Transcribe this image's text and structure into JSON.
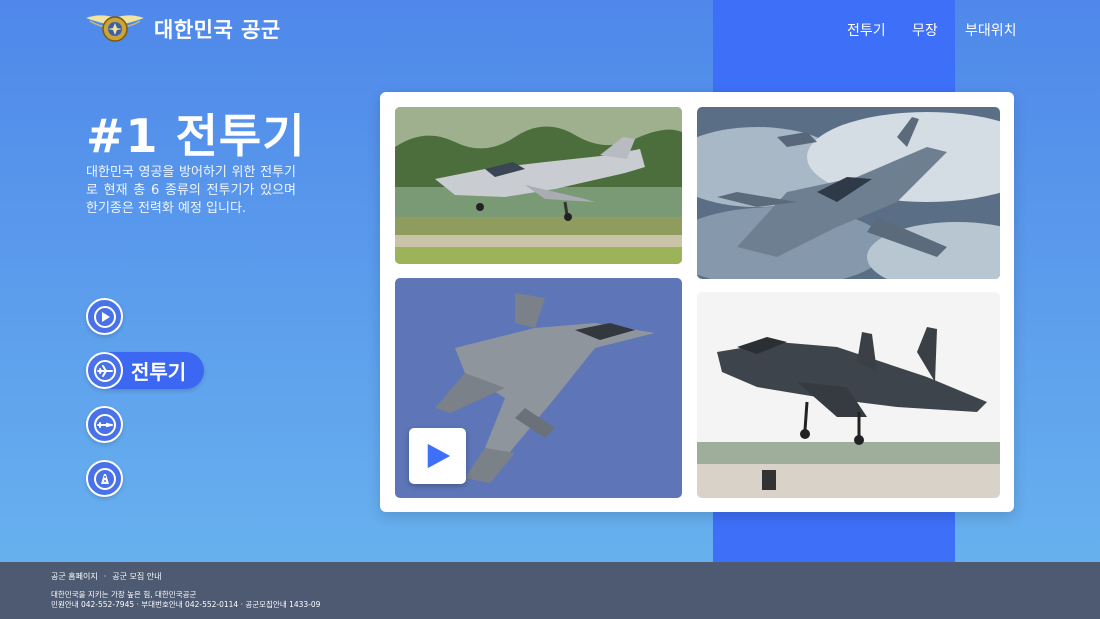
{
  "brand": {
    "name": "대한민국 공군",
    "logo_icon": "air-force-emblem-icon"
  },
  "nav": [
    {
      "label": "전투기"
    },
    {
      "label": "무장"
    },
    {
      "label": "부대위치"
    }
  ],
  "hero": {
    "title": "#1 전투기",
    "description": "대한민국 영공을 방어하기 위한 전투기로 현재 총 6 종류의 전투기가 있으며 한기종은 전력화 예정 입니다."
  },
  "side_menu": [
    {
      "icon": "play-icon"
    },
    {
      "icon": "fighter-jet-icon",
      "label": "전투기",
      "active": true
    },
    {
      "icon": "missile-icon"
    },
    {
      "icon": "location-road-icon"
    }
  ],
  "gallery": {
    "items": [
      {
        "alt": "FA-50 trainer jet taking off"
      },
      {
        "alt": "KF-21 fighter in flight"
      },
      {
        "alt": "F-35 stealth fighter"
      },
      {
        "alt": "F-15K fighter landing"
      }
    ],
    "play_icon": "play-icon"
  },
  "footer": {
    "links": [
      "공군 홈페이지",
      "공군 모집 안내"
    ],
    "slogan": "대한민국을 지키는 가장 높은 힘, 대한민국공군",
    "contacts": "민원안내 042-552-7945  ·  부대번호안내 042-552-0114  ·  공군모집안내 1433-09"
  },
  "colors": {
    "accent": "#3d6ff8",
    "footer": "#4d5a72",
    "background": "#5b9cec"
  }
}
